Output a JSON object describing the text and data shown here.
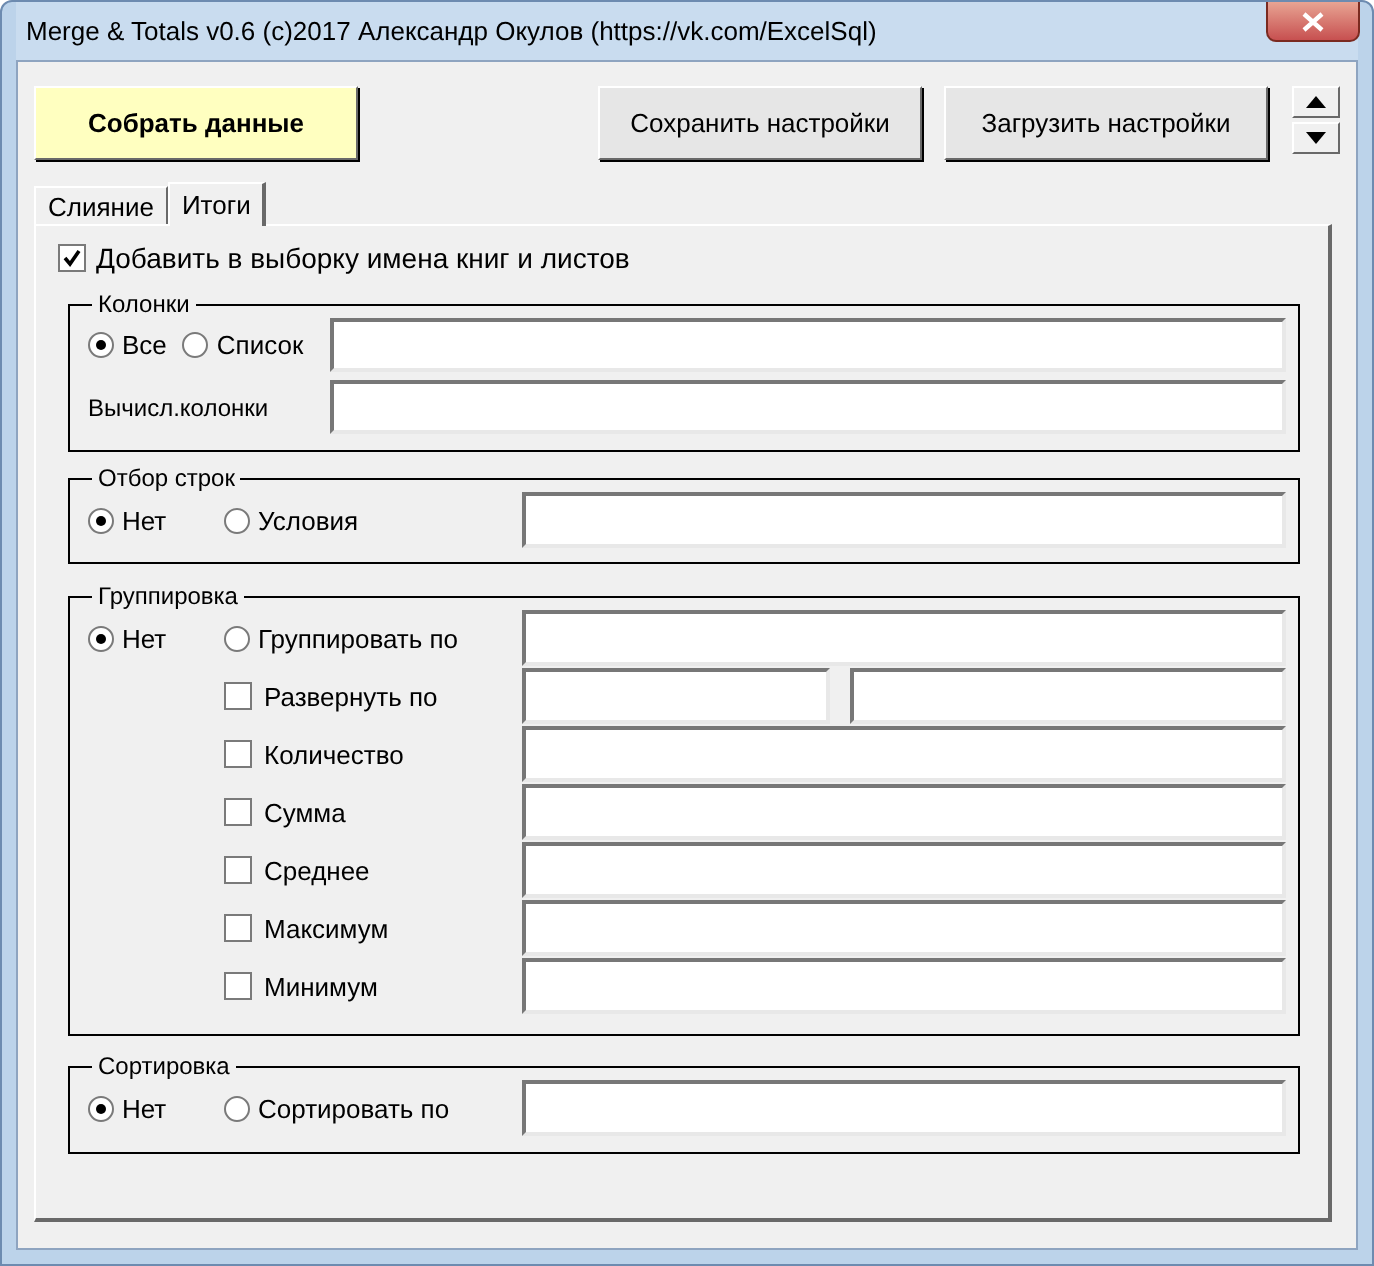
{
  "window": {
    "title": "Merge & Totals v0.6 (c)2017 Александр Окулов (https://vk.com/ExcelSql)"
  },
  "toolbar": {
    "collect_button": "Собрать данные",
    "save_button": "Сохранить настройки",
    "load_button": "Загрузить настройки"
  },
  "tabs": [
    {
      "label": "Слияние",
      "selected": false
    },
    {
      "label": "Итоги",
      "selected": true
    }
  ],
  "add_names": {
    "label": "Добавить в выборку имена книг и листов",
    "checked": true
  },
  "columns_group": {
    "title": "Колонки",
    "options": [
      {
        "label": "Все",
        "selected": true
      },
      {
        "label": "Список",
        "selected": false
      }
    ],
    "computed_label": "Вычисл.колонки"
  },
  "row_filter": {
    "title": "Отбор строк",
    "options": [
      {
        "label": "Нет",
        "selected": true
      },
      {
        "label": "Условия",
        "selected": false
      }
    ]
  },
  "grouping": {
    "title": "Группировка",
    "options": [
      {
        "label": "Нет",
        "selected": true
      },
      {
        "label": "Группировать по",
        "selected": false
      }
    ],
    "aggregates": [
      {
        "label": "Развернуть по",
        "checked": false,
        "kind": "split"
      },
      {
        "label": "Количество",
        "checked": false,
        "kind": "single"
      },
      {
        "label": "Сумма",
        "checked": false,
        "kind": "single"
      },
      {
        "label": "Среднее",
        "checked": false,
        "kind": "single"
      },
      {
        "label": "Максимум",
        "checked": false,
        "kind": "single"
      },
      {
        "label": "Минимум",
        "checked": false,
        "kind": "single"
      }
    ]
  },
  "sorting": {
    "title": "Сортировка",
    "options": [
      {
        "label": "Нет",
        "selected": true
      },
      {
        "label": "Сортировать по",
        "selected": false
      }
    ]
  }
}
